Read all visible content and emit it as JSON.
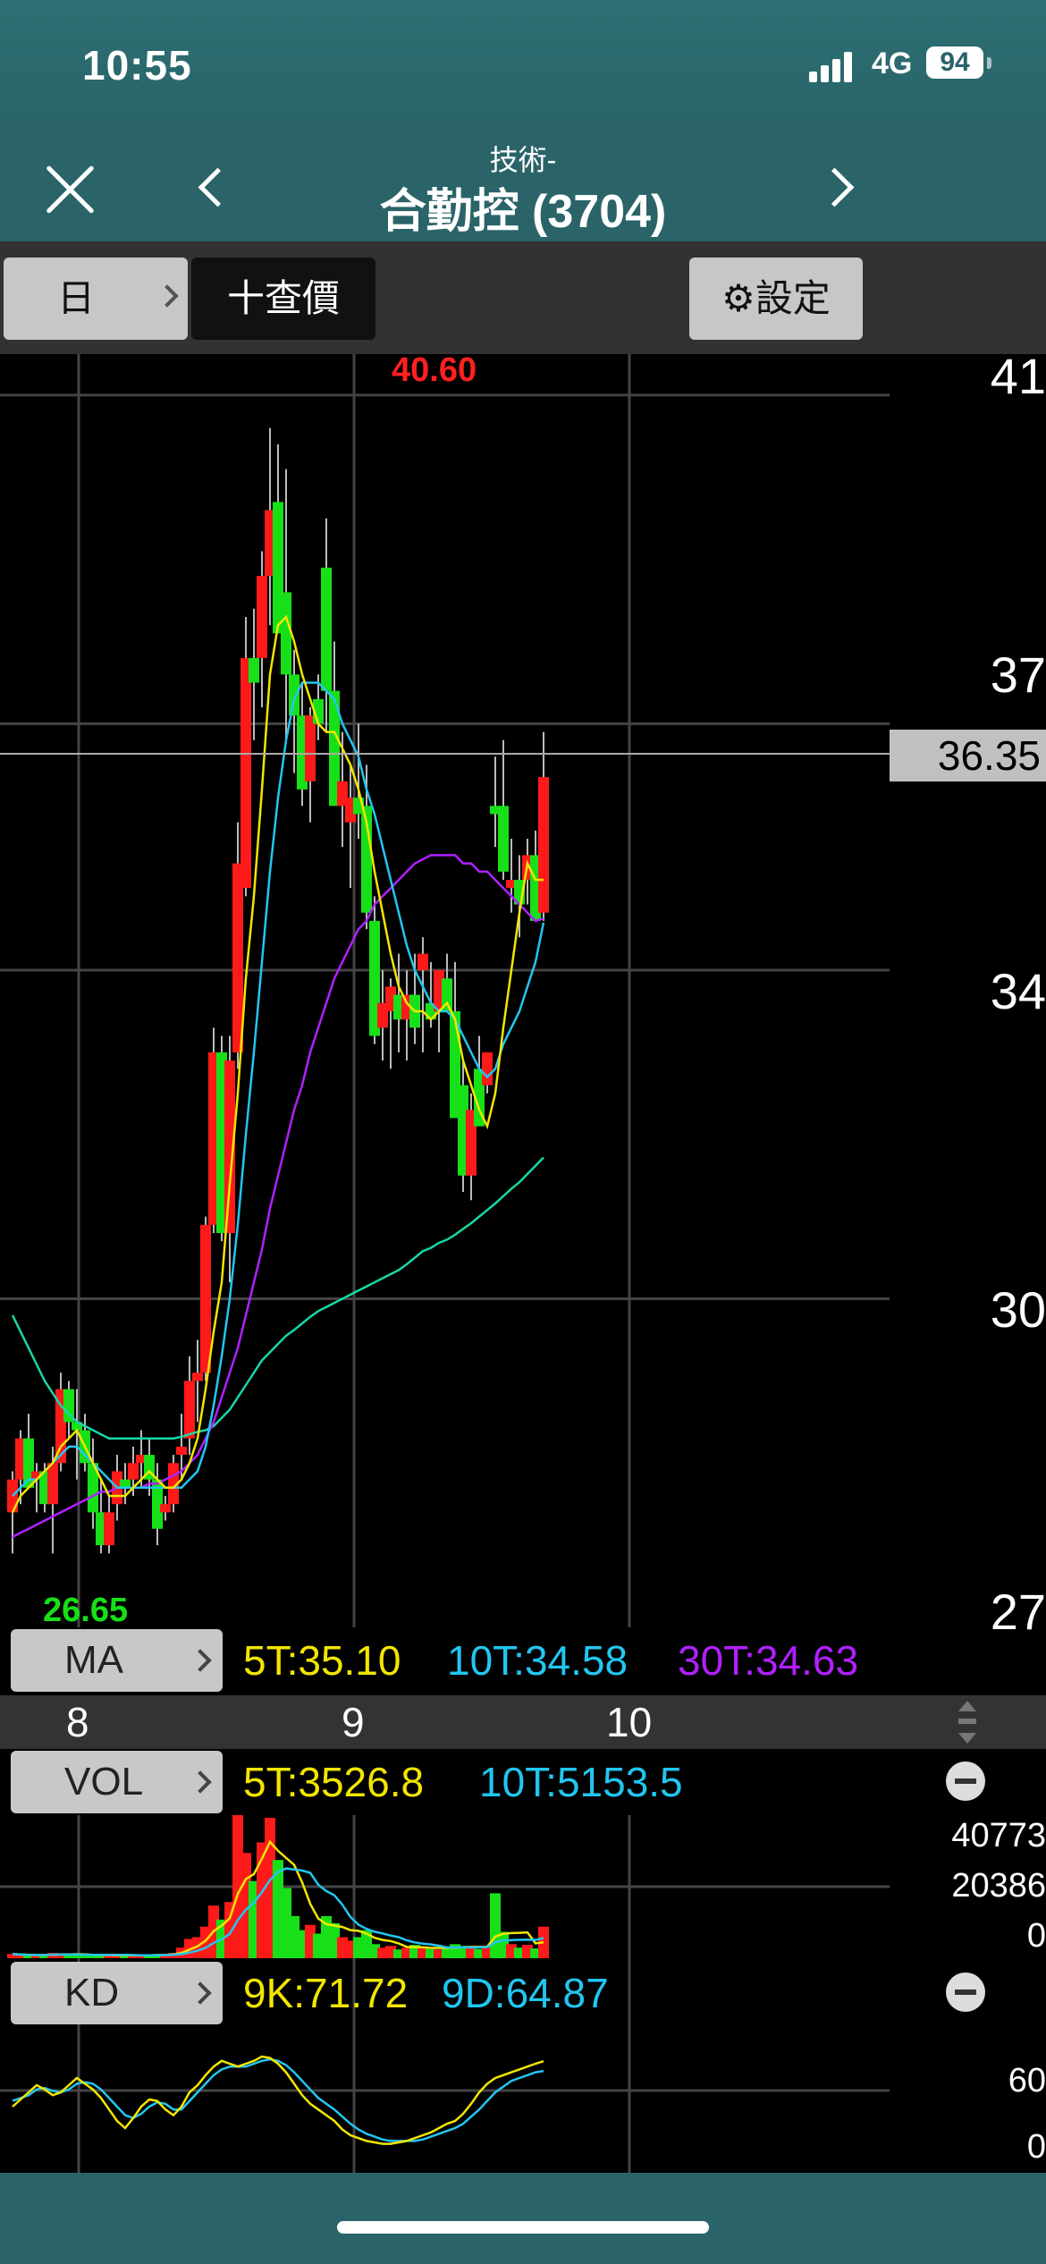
{
  "status": {
    "time": "10:55",
    "network": "4G",
    "battery": "94"
  },
  "nav": {
    "subtitle": "技術-",
    "title": "合勤控 (3704)"
  },
  "toolbar": {
    "period_label": "日",
    "quote_label": "十查價",
    "settings_label": "⚙設定"
  },
  "price_axis": {
    "labels": [
      "41",
      "37",
      "34",
      "30",
      "27"
    ],
    "current": "36.35"
  },
  "annotations": {
    "high": "40.60",
    "low": "26.65"
  },
  "dates": [
    "8",
    "9",
    "10"
  ],
  "ma": {
    "pill": "MA",
    "values": [
      "5T:35.10",
      "10T:34.58",
      "30T:34.63"
    ]
  },
  "vol": {
    "pill": "VOL",
    "values": [
      "5T:3526.8",
      "10T:5153.5"
    ],
    "axis": [
      "40773",
      "20386",
      "0"
    ]
  },
  "kd": {
    "pill": "KD",
    "values": [
      "9K:71.72",
      "9D:64.87"
    ],
    "axis": [
      "60",
      "0"
    ]
  },
  "colors": {
    "up": "#ff1a1a",
    "down": "#18e018",
    "ma5": "#f2e600",
    "ma10": "#22c6f0",
    "ma30": "#b020ff",
    "ma_long": "#18d6a8"
  },
  "chart_data": {
    "type": "candlestick",
    "ylim": [
      26,
      41.5
    ],
    "high": 40.6,
    "low": 26.65,
    "last": 36.35,
    "ohlc": [
      [
        27.4,
        27.9,
        26.9,
        27.8
      ],
      [
        27.8,
        28.4,
        27.5,
        28.3
      ],
      [
        28.3,
        28.6,
        27.7,
        27.7
      ],
      [
        27.8,
        28.0,
        27.4,
        27.9
      ],
      [
        27.9,
        28.0,
        27.4,
        27.5
      ],
      [
        27.5,
        28.2,
        26.9,
        28.0
      ],
      [
        28.0,
        29.1,
        27.9,
        28.9
      ],
      [
        28.9,
        29.0,
        28.3,
        28.5
      ],
      [
        28.5,
        28.9,
        27.8,
        28.4
      ],
      [
        28.4,
        28.6,
        27.9,
        28.0
      ],
      [
        28.0,
        28.3,
        27.2,
        27.4
      ],
      [
        27.4,
        27.8,
        26.9,
        27.0
      ],
      [
        27.0,
        27.6,
        26.9,
        27.4
      ],
      [
        27.5,
        28.1,
        27.3,
        27.9
      ],
      [
        27.8,
        28.0,
        27.5,
        27.7
      ],
      [
        27.8,
        28.2,
        27.6,
        28.0
      ],
      [
        28.0,
        28.4,
        27.7,
        28.1
      ],
      [
        28.1,
        28.3,
        27.6,
        27.8
      ],
      [
        27.8,
        28.0,
        27.0,
        27.2
      ],
      [
        27.4,
        27.6,
        27.3,
        27.5
      ],
      [
        27.5,
        28.1,
        27.4,
        28.0
      ],
      [
        28.1,
        28.6,
        27.8,
        28.2
      ],
      [
        28.3,
        29.3,
        28.1,
        29.0
      ],
      [
        29.0,
        29.5,
        28.5,
        29.1
      ],
      [
        29.1,
        31.0,
        29.0,
        30.9
      ],
      [
        30.9,
        33.3,
        30.8,
        33.0
      ],
      [
        33.0,
        33.2,
        30.7,
        30.8
      ],
      [
        30.8,
        33.2,
        30.2,
        32.9
      ],
      [
        33.0,
        35.8,
        32.8,
        35.3
      ],
      [
        35.0,
        38.3,
        34.9,
        37.8
      ],
      [
        37.8,
        38.4,
        36.8,
        37.5
      ],
      [
        37.8,
        39.1,
        37.2,
        38.8
      ],
      [
        38.8,
        40.6,
        38.2,
        39.6
      ],
      [
        39.7,
        40.4,
        38.3,
        38.1
      ],
      [
        38.6,
        40.1,
        36.8,
        37.6
      ],
      [
        37.6,
        37.9,
        36.4,
        37.1
      ],
      [
        37.1,
        37.5,
        36.0,
        36.2
      ],
      [
        36.3,
        37.2,
        35.8,
        37.1
      ],
      [
        37.3,
        37.6,
        36.8,
        37.0
      ],
      [
        38.9,
        39.5,
        36.9,
        37.4
      ],
      [
        37.4,
        38.0,
        36.0,
        36.0
      ],
      [
        36.0,
        36.9,
        35.5,
        36.3
      ],
      [
        35.8,
        36.5,
        35.0,
        36.1
      ],
      [
        36.1,
        37.0,
        35.6,
        35.9
      ],
      [
        36.0,
        36.5,
        34.5,
        34.7
      ],
      [
        34.6,
        34.9,
        33.1,
        33.2
      ],
      [
        33.3,
        34.0,
        32.9,
        33.6
      ],
      [
        33.5,
        33.9,
        32.8,
        33.8
      ],
      [
        33.7,
        34.2,
        33.0,
        33.4
      ],
      [
        33.4,
        34.0,
        32.9,
        33.7
      ],
      [
        33.7,
        34.2,
        33.1,
        33.3
      ],
      [
        34.0,
        34.4,
        33.0,
        34.2
      ],
      [
        33.6,
        34.1,
        33.3,
        33.4
      ],
      [
        33.5,
        34.0,
        33.0,
        34.0
      ],
      [
        33.9,
        34.2,
        33.6,
        33.5
      ],
      [
        33.5,
        34.1,
        32.6,
        32.2
      ],
      [
        32.6,
        32.9,
        31.3,
        31.5
      ],
      [
        31.5,
        32.5,
        31.2,
        32.3
      ],
      [
        32.8,
        33.2,
        32.3,
        32.1
      ],
      [
        32.6,
        33.0,
        32.5,
        33.0
      ],
      [
        36.0,
        36.6,
        35.5,
        35.9
      ],
      [
        36.0,
        36.8,
        35.1,
        35.2
      ],
      [
        35.0,
        35.6,
        34.7,
        35.1
      ],
      [
        35.1,
        35.4,
        34.4,
        34.8
      ],
      [
        35.1,
        35.6,
        34.8,
        35.4
      ],
      [
        35.4,
        35.7,
        34.7,
        34.6
      ],
      [
        34.7,
        36.9,
        34.6,
        36.35
      ]
    ],
    "ma5": [
      27.4,
      27.6,
      27.7,
      27.8,
      27.9,
      28.0,
      28.2,
      28.3,
      28.4,
      28.2,
      28.0,
      27.8,
      27.6,
      27.6,
      27.6,
      27.7,
      27.8,
      27.9,
      27.8,
      27.7,
      27.7,
      27.8,
      28.0,
      28.3,
      28.9,
      29.6,
      30.2,
      31.4,
      32.5,
      33.9,
      34.9,
      36.2,
      37.6,
      38.2,
      38.3,
      38.0,
      37.6,
      37.3,
      37.0,
      36.9,
      36.9,
      36.7,
      36.5,
      36.2,
      35.8,
      35.2,
      34.7,
      34.2,
      33.8,
      33.6,
      33.5,
      33.5,
      33.4,
      33.5,
      33.6,
      33.4,
      32.9,
      32.6,
      32.3,
      32.1,
      32.5,
      33.3,
      34.0,
      34.7,
      35.3,
      35.1,
      35.1
    ],
    "ma10": [
      27.6,
      27.7,
      27.8,
      27.8,
      27.9,
      28.0,
      28.1,
      28.2,
      28.2,
      28.1,
      28.0,
      27.9,
      27.8,
      27.7,
      27.7,
      27.7,
      27.7,
      27.7,
      27.7,
      27.7,
      27.7,
      27.7,
      27.8,
      27.9,
      28.2,
      28.7,
      29.3,
      30.0,
      30.9,
      32.0,
      33.0,
      34.1,
      35.2,
      36.1,
      36.8,
      37.3,
      37.5,
      37.5,
      37.5,
      37.4,
      37.3,
      37.0,
      36.8,
      36.6,
      36.2,
      35.9,
      35.5,
      35.1,
      34.7,
      34.3,
      34.0,
      33.8,
      33.6,
      33.5,
      33.5,
      33.4,
      33.2,
      33.0,
      32.8,
      32.7,
      32.8,
      33.1,
      33.3,
      33.5,
      33.8,
      34.1,
      34.58
    ],
    "ma30": [
      27.1,
      27.15,
      27.2,
      27.25,
      27.3,
      27.35,
      27.4,
      27.45,
      27.5,
      27.55,
      27.6,
      27.65,
      27.65,
      27.7,
      27.7,
      27.7,
      27.7,
      27.75,
      27.75,
      27.8,
      27.85,
      27.9,
      28.0,
      28.1,
      28.3,
      28.5,
      28.8,
      29.1,
      29.4,
      29.8,
      30.2,
      30.6,
      31.1,
      31.5,
      31.9,
      32.3,
      32.6,
      33.0,
      33.3,
      33.6,
      33.9,
      34.1,
      34.3,
      34.5,
      34.6,
      34.8,
      34.9,
      35.0,
      35.1,
      35.2,
      35.3,
      35.35,
      35.4,
      35.4,
      35.4,
      35.4,
      35.3,
      35.3,
      35.2,
      35.2,
      35.1,
      35.0,
      34.9,
      34.8,
      34.7,
      34.6,
      34.63
    ],
    "ma_long": [
      29.8,
      29.6,
      29.4,
      29.2,
      29.0,
      28.85,
      28.7,
      28.6,
      28.5,
      28.45,
      28.4,
      28.35,
      28.3,
      28.3,
      28.3,
      28.3,
      28.3,
      28.3,
      28.3,
      28.3,
      28.3,
      28.32,
      28.35,
      28.38,
      28.4,
      28.45,
      28.55,
      28.65,
      28.8,
      28.95,
      29.1,
      29.25,
      29.35,
      29.45,
      29.55,
      29.62,
      29.7,
      29.78,
      29.85,
      29.9,
      29.95,
      30.0,
      30.05,
      30.1,
      30.15,
      30.2,
      30.25,
      30.3,
      30.35,
      30.42,
      30.5,
      30.58,
      30.62,
      30.68,
      30.72,
      30.78,
      30.85,
      30.92,
      31.0,
      31.08,
      31.16,
      31.25,
      31.34,
      31.42,
      31.52,
      31.62,
      31.72
    ],
    "volume": [
      1200,
      900,
      800,
      700,
      1000,
      1500,
      1300,
      900,
      1000,
      700,
      800,
      1000,
      900,
      700,
      800,
      900,
      700,
      800,
      1200,
      1000,
      1500,
      3000,
      5500,
      6000,
      9000,
      15000,
      11000,
      16000,
      40773,
      30000,
      22000,
      33000,
      40000,
      28000,
      20000,
      12000,
      8000,
      9500,
      7000,
      12000,
      10000,
      6000,
      5000,
      6000,
      8000,
      4000,
      3000,
      3500,
      2500,
      3000,
      3800,
      2800,
      2600,
      2500,
      3000,
      4000,
      3500,
      3000,
      2600,
      3200,
      18500,
      7500,
      4000,
      3000,
      3800,
      2800,
      9000
    ],
    "k": [
      40,
      45,
      50,
      55,
      52,
      48,
      50,
      55,
      60,
      56,
      52,
      46,
      38,
      30,
      25,
      32,
      40,
      45,
      44,
      38,
      34,
      40,
      50,
      55,
      62,
      68,
      72,
      70,
      68,
      70,
      72,
      75,
      74,
      70,
      64,
      56,
      48,
      42,
      38,
      34,
      30,
      24,
      20,
      18,
      16,
      15,
      14,
      14,
      15,
      16,
      18,
      20,
      22,
      25,
      28,
      30,
      35,
      42,
      50,
      56,
      60,
      62,
      64,
      66,
      68,
      70,
      71.72
    ],
    "d": [
      44,
      46,
      48,
      52,
      53,
      51,
      50,
      52,
      56,
      57,
      56,
      52,
      46,
      40,
      34,
      32,
      35,
      40,
      43,
      42,
      38,
      38,
      44,
      50,
      56,
      62,
      66,
      68,
      68,
      68,
      70,
      72,
      73,
      72,
      69,
      64,
      58,
      52,
      46,
      42,
      38,
      33,
      28,
      24,
      21,
      19,
      17,
      16,
      16,
      16,
      16,
      17,
      19,
      21,
      23,
      25,
      28,
      33,
      38,
      44,
      50,
      54,
      58,
      60,
      62,
      64,
      64.87
    ]
  }
}
